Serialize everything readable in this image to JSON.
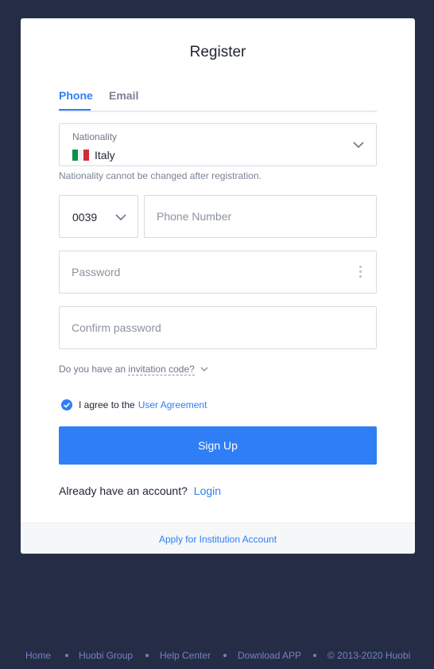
{
  "form": {
    "title": "Register",
    "tabs": [
      {
        "label": "Phone",
        "active": true
      },
      {
        "label": "Email",
        "active": false
      }
    ],
    "nationality": {
      "label": "Nationality",
      "value": "Italy",
      "flag_icon": "italy-flag-icon",
      "hint": "Nationality cannot be changed after registration."
    },
    "phone": {
      "country_code": "0039",
      "placeholder": "Phone Number"
    },
    "password": {
      "placeholder": "Password"
    },
    "confirm_password": {
      "placeholder": "Confirm password"
    },
    "invitation": {
      "prefix": "Do you have an",
      "link": "invitation code?"
    },
    "agreement": {
      "checked": true,
      "text": "I agree to the",
      "link": "User Agreement"
    },
    "submit_label": "Sign Up",
    "login": {
      "text": "Already have an account?",
      "link": "Login"
    },
    "institution_link": "Apply for Institution Account"
  },
  "footer": {
    "links": [
      "Home",
      "Huobi Group",
      "Help Center",
      "Download APP",
      "© 2013-2020 Huobi"
    ]
  },
  "colors": {
    "background": "#252d46",
    "accent": "#2f7ef6",
    "footer_text": "#6f84bf"
  }
}
